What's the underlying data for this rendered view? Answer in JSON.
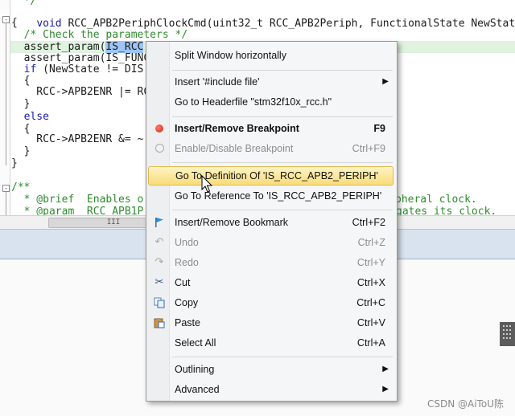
{
  "editor": {
    "lines": [
      "  */",
      "void RCC_APB2PeriphClockCmd(uint32_t RCC_APB2Periph, FunctionalState NewState)",
      "{",
      "  /* Check the parameters */",
      "  assert_param(IS_RCC",
      "  assert_param(IS_FUNC",
      "  if (NewState != DIS",
      "  {",
      "    RCC->APB2ENR |= RC",
      "  }",
      "  else",
      "  {",
      "    RCC->APB2ENR &= ~",
      "  }",
      "}",
      "",
      "/**",
      "  * @brief  Enables o",
      "  * @param  RCC_APB1P"
    ],
    "right_fragments": {
      "line17": "pheral clock.",
      "line18": "gates its clock."
    },
    "fold_markers": [
      "-",
      "-",
      "-"
    ],
    "scroll_thumb_label": "III"
  },
  "context_menu": {
    "items": [
      {
        "label": "Split Window horizontally",
        "shortcut": "",
        "icon": "",
        "state": "normal"
      },
      {
        "label": "Insert '#include file'",
        "shortcut": "",
        "icon": "",
        "state": "submenu"
      },
      {
        "label": "Go to Headerfile \"stm32f10x_rcc.h\"",
        "shortcut": "",
        "icon": "",
        "state": "normal"
      },
      {
        "label": "Insert/Remove Breakpoint",
        "shortcut": "F9",
        "icon": "breakpoint-icon",
        "state": "bold"
      },
      {
        "label": "Enable/Disable Breakpoint",
        "shortcut": "Ctrl+F9",
        "icon": "disabled-breakpoint-icon",
        "state": "disabled"
      },
      {
        "label": "Go To Definition Of 'IS_RCC_APB2_PERIPH'",
        "shortcut": "",
        "icon": "",
        "state": "hover"
      },
      {
        "label": "Go To Reference To 'IS_RCC_APB2_PERIPH'",
        "shortcut": "",
        "icon": "",
        "state": "normal"
      },
      {
        "label": "Insert/Remove Bookmark",
        "shortcut": "Ctrl+F2",
        "icon": "bookmark-flag-icon",
        "state": "normal"
      },
      {
        "label": "Undo",
        "shortcut": "Ctrl+Z",
        "icon": "undo-icon",
        "state": "disabled"
      },
      {
        "label": "Redo",
        "shortcut": "Ctrl+Y",
        "icon": "redo-icon",
        "state": "disabled"
      },
      {
        "label": "Cut",
        "shortcut": "Ctrl+X",
        "icon": "scissors-icon",
        "state": "normal"
      },
      {
        "label": "Copy",
        "shortcut": "Ctrl+C",
        "icon": "copy-icon",
        "state": "normal"
      },
      {
        "label": "Paste",
        "shortcut": "Ctrl+V",
        "icon": "paste-icon",
        "state": "normal"
      },
      {
        "label": "Select All",
        "shortcut": "Ctrl+A",
        "icon": "",
        "state": "normal"
      },
      {
        "label": "Outlining",
        "shortcut": "",
        "icon": "",
        "state": "submenu"
      },
      {
        "label": "Advanced",
        "shortcut": "",
        "icon": "",
        "state": "submenu"
      }
    ],
    "submenu_arrow": "▶"
  },
  "watermark": "CSDN @AiToU陈",
  "colors": {
    "hover_top": "#fdf4c3",
    "hover_bottom": "#f8dc7a",
    "selection": "#9cc5f5",
    "keyword": "#1a1aa6",
    "comment": "#2e8b2e"
  }
}
